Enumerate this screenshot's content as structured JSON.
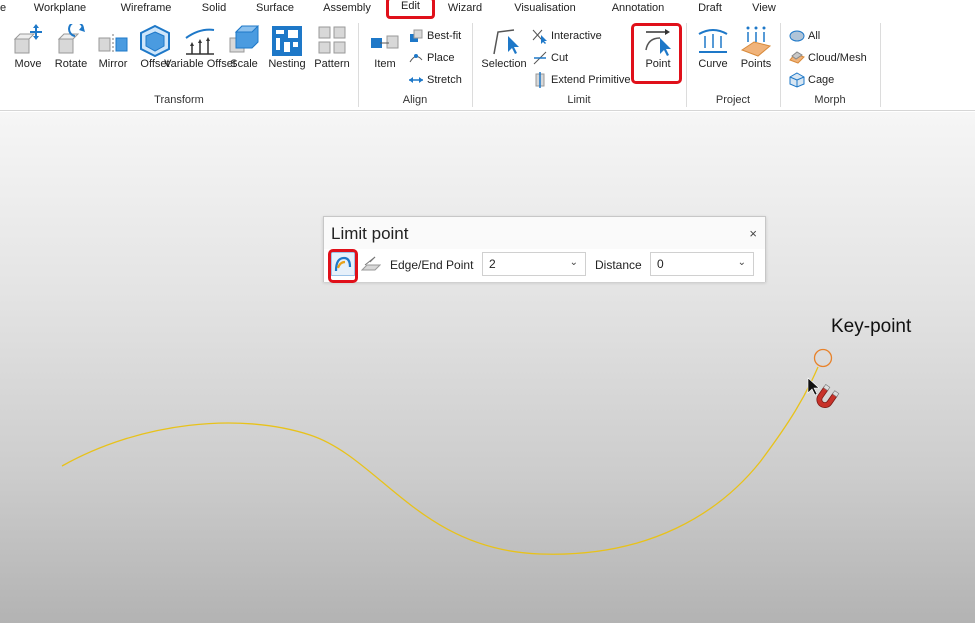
{
  "menubar": {
    "items": [
      {
        "label": "e"
      },
      {
        "label": "Workplane"
      },
      {
        "label": "Wireframe"
      },
      {
        "label": "Solid"
      },
      {
        "label": "Surface"
      },
      {
        "label": "Assembly"
      },
      {
        "label": "Edit"
      },
      {
        "label": "Wizard"
      },
      {
        "label": "Visualisation"
      },
      {
        "label": "Annotation"
      },
      {
        "label": "Draft"
      },
      {
        "label": "View"
      }
    ],
    "active": "Edit"
  },
  "ribbon": {
    "transform": {
      "title": "Transform",
      "buttons": [
        "Move",
        "Rotate",
        "Mirror",
        "Offset",
        "Variable Offset",
        "Scale",
        "Nesting",
        "Pattern"
      ]
    },
    "align": {
      "title": "Align",
      "item_label": "Item",
      "small": [
        "Best-fit",
        "Place",
        "Stretch"
      ]
    },
    "limit": {
      "title": "Limit",
      "selection_label": "Selection",
      "small": [
        "Interactive",
        "Cut",
        "Extend Primitive"
      ],
      "point_label": "Point"
    },
    "project": {
      "title": "Project",
      "buttons": [
        "Curve",
        "Points"
      ]
    },
    "morph": {
      "title": "Morph",
      "small": [
        "All",
        "Cloud/Mesh",
        "Cage"
      ]
    }
  },
  "dialog": {
    "title": "Limit point",
    "close": "×",
    "edge_label": "Edge/End Point",
    "edge_value": "2",
    "distance_label": "Distance",
    "distance_value": "0"
  },
  "viewport": {
    "keypoint_label": "Key-point"
  },
  "colors": {
    "highlight": "#e0101a",
    "curve": "#e8c21a",
    "keypoint": "#e8822a",
    "icon_blue": "#1e78c8"
  }
}
